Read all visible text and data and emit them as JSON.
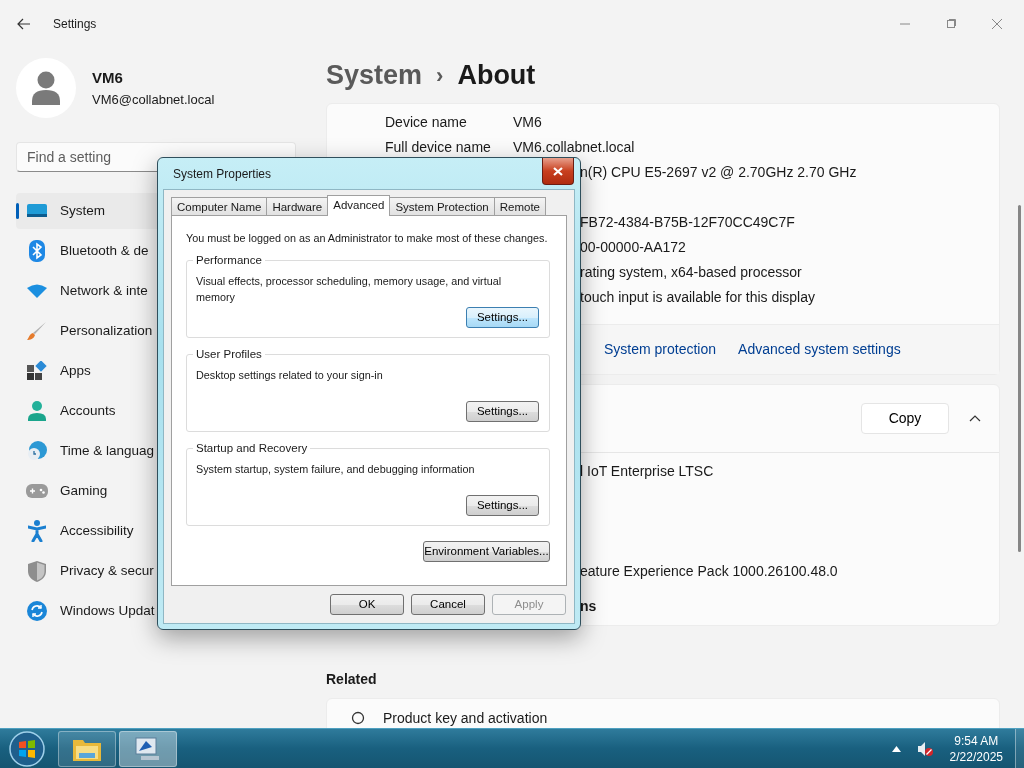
{
  "settings": {
    "title": "Settings",
    "user": {
      "name": "VM6",
      "email": "VM6@collabnet.local"
    },
    "search": {
      "placeholder": "Find a setting"
    },
    "nav": [
      {
        "label": "System",
        "selected": true
      },
      {
        "label": "Bluetooth & de",
        "selected": false
      },
      {
        "label": "Network & inte",
        "selected": false
      },
      {
        "label": "Personalization",
        "selected": false
      },
      {
        "label": "Apps",
        "selected": false
      },
      {
        "label": "Accounts",
        "selected": false
      },
      {
        "label": "Time & languag",
        "selected": false
      },
      {
        "label": "Gaming",
        "selected": false
      },
      {
        "label": "Accessibility",
        "selected": false
      },
      {
        "label": "Privacy & secur",
        "selected": false
      },
      {
        "label": "Windows Updat",
        "selected": false
      }
    ],
    "breadcrumb": {
      "parent": "System",
      "separator": "›",
      "current": "About"
    },
    "device_specs": {
      "rows": [
        {
          "kind": "full",
          "label": "Device name",
          "value": "VM6"
        },
        {
          "kind": "full",
          "label": "Full device name",
          "value": "VM6.collabnet.local"
        },
        {
          "kind": "partial",
          "value": "n(R) CPU E5-2697 v2 @ 2.70GHz   2.70 GHz"
        },
        {
          "kind": "covered"
        },
        {
          "kind": "partial",
          "value": "FB72-4384-B75B-12F70CC49C7F"
        },
        {
          "kind": "partial",
          "value": "00-00000-AA172"
        },
        {
          "kind": "partial",
          "value": "rating system, x64-based processor"
        },
        {
          "kind": "partial",
          "value": "touch input is available for this display"
        }
      ],
      "links": [
        "System protection",
        "Advanced system settings"
      ]
    },
    "windows_specs": {
      "copy_button": "Copy",
      "expanded": true,
      "rows": [
        {
          "kind": "partial",
          "value": "l IoT Enterprise LTSC"
        },
        {
          "kind": "covered"
        },
        {
          "kind": "covered"
        },
        {
          "kind": "covered"
        },
        {
          "kind": "partial",
          "value": "eature Experience Pack 1000.26100.48.0"
        }
      ],
      "link": "ns"
    },
    "related": {
      "heading": "Related",
      "items": [
        {
          "label": "Product key and activation"
        }
      ]
    }
  },
  "dialog": {
    "title": "System Properties",
    "tabs": [
      {
        "label": "Computer Name",
        "selected": false
      },
      {
        "label": "Hardware",
        "selected": false
      },
      {
        "label": "Advanced",
        "selected": true
      },
      {
        "label": "System Protection",
        "selected": false
      },
      {
        "label": "Remote",
        "selected": false
      }
    ],
    "notice": "You must be logged on as an Administrator to make most of these changes.",
    "groups": [
      {
        "title": "Performance",
        "description": "Visual effects, processor scheduling, memory usage, and virtual memory",
        "button": "Settings...",
        "focused": true
      },
      {
        "title": "User Profiles",
        "description": "Desktop settings related to your sign-in",
        "button": "Settings...",
        "focused": false
      },
      {
        "title": "Startup and Recovery",
        "description": "System startup, system failure, and debugging information",
        "button": "Settings...",
        "focused": false
      }
    ],
    "env_button": "Environment Variables...",
    "buttons": [
      {
        "label": "OK",
        "disabled": false
      },
      {
        "label": "Cancel",
        "disabled": false
      },
      {
        "label": "Apply",
        "disabled": true
      }
    ]
  },
  "taskbar": {
    "apps": [
      {
        "active": false
      },
      {
        "active": true
      }
    ],
    "volume_muted": true,
    "time": "9:54 AM",
    "date": "2/22/2025"
  }
}
